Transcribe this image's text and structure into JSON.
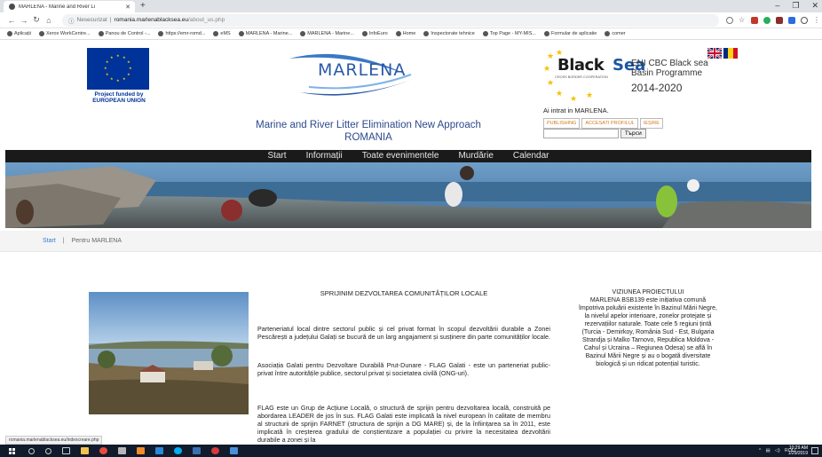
{
  "browser": {
    "tab_title": "MARLENA - Marine and River Li",
    "new_tab": "+",
    "url_info": "ⓘ",
    "url_security": "Nesecurizat",
    "url_domain": "romania.marlenablacksea.eu",
    "url_path": "/about_us.php",
    "bookmarks": [
      "Aplicații",
      "Xerox WorkCentre...",
      "Panou de Control -...",
      "https://emr-romd...",
      "eMS",
      "MARLENA - Marine...",
      "MARLENA - Marine...",
      "InfoEuro",
      "Home",
      "Inspectorate tehnice",
      "Top Page - MY-MIS...",
      "Formular de aplicatie",
      "comer"
    ]
  },
  "header": {
    "eu_text_1": "Project funded by",
    "eu_text_2": "EUROPEAN UNION",
    "logo_word": "MARLENA",
    "title_1": "Marine and River Litter Elimination New Approach",
    "title_2": "ROMANIA",
    "bs_word_1": "Black",
    "bs_word_2": "Sea",
    "bs_sub": "CROSS BORDER COOPERATION",
    "bs_prog_1": "ENI CBC Black sea",
    "bs_prog_2": "Basin Programme",
    "bs_years": "2014-2020"
  },
  "login": {
    "message": "Ai intrat in MARLENA.",
    "publishing": "PUBLISHING",
    "profile": "ACCESATI PROFILUL",
    "logout": "IEȘIRE",
    "search_button": "Търси"
  },
  "nav": [
    "Start",
    "Informații",
    "Toate evenimentele",
    "Murdărie",
    "Calendar"
  ],
  "breadcrumb": {
    "start": "Start",
    "separator": "|",
    "current": "Pentru MARLENA"
  },
  "content": {
    "section_title": "SPRIJINIM DEZVOLTAREA COMUNITĂȚILOR LOCALE",
    "p1": "Parteneriatul local dintre sectorul public și cel privat format în scopul dezvoltării durabile a Zonei Pescărești a județului Galați se bucură de un larg angajament și susținere din parte comunităților locale.",
    "p2": "Asociația Galati pentru Dezvoltare Durabilă Prut-Dunare - FLAG Galati - este un parteneriat public-privat între autoritățile publice, sectorul privat și societatea civilă (ONG-uri).",
    "p3": "FLAG este un Grup de Acțiune Locală, o structură de sprijin pentru dezvoltarea locală, construită pe abordarea LEADER de jos în sus. FLAG Galati este implicată la nivel european în calitate de membru al structurii de sprijin FARNET (structura de sprijin a DG MARE) și, de la înființarea sa în 2011, este implicată în creșterea gradului de conștientizare a populației cu privire la necesitatea dezvoltării durabile a zonei și la"
  },
  "vision": {
    "title": "VIZIUNEA PROIECTULUI",
    "text": "MARLENA BSB139 este inițiativa comună împotriva poluării existente în Bazinul Mării Negre, la nivelul apelor interioare, zonelor protejate și rezervațiilor naturale. Toate cele 5 regiuni țintă (Turcia - Demirkoy, România Sud - Est, Bulgaria Strandja și Malko Tarnovo, Republica Moldova - Cahul și Ucraina – Regiunea Odesa) se află în Bazinul Mării Negre și au o bogată diversitate biologică și un ridicat potențial turistic."
  },
  "statusbar": "romania.marlenablacksea.eu/indexcreare.php",
  "taskbar": {
    "tray_lang": "ROU",
    "time": "10:29 AM",
    "date": "1/29/2019"
  }
}
